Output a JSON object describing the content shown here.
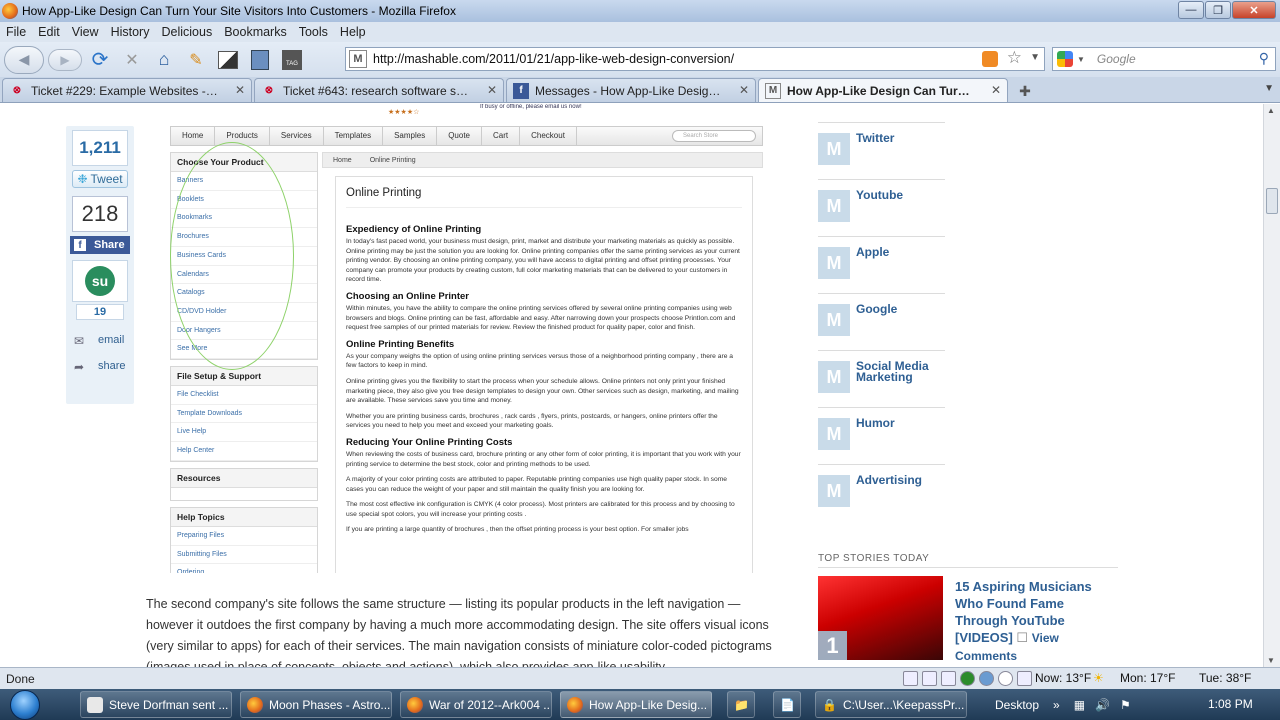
{
  "window": {
    "title": "How App-Like Design Can Turn Your Site Visitors Into Customers - Mozilla Firefox"
  },
  "menu": [
    "File",
    "Edit",
    "View",
    "History",
    "Delicious",
    "Bookmarks",
    "Tools",
    "Help"
  ],
  "nav": {
    "url": "http://mashable.com/2011/01/21/app-like-web-design-conversion/",
    "search_placeholder": "Google",
    "tag_label": "TAG"
  },
  "tabs": [
    {
      "label": "Ticket #229: Example Websites - Ide...",
      "icon": "trac-icon",
      "active": false
    },
    {
      "label": "Ticket #643: research software so th...",
      "icon": "trac-icon",
      "active": false
    },
    {
      "label": "Messages - How App-Like Design C...",
      "icon": "facebook-icon",
      "active": false
    },
    {
      "label": "How App-Like Design Can Turn Y...",
      "icon": "mashable-icon",
      "active": true
    }
  ],
  "share": {
    "tweet_count": "1,211",
    "tweet_label": "Tweet",
    "fb_count": "218",
    "fb_label": "Share",
    "su_count": "19",
    "email_label": "email",
    "share_label": "share"
  },
  "shot": {
    "top_hint": "If busy or offline, please email us now!",
    "topnav": [
      "Home",
      "Products",
      "Services",
      "Templates",
      "Samples",
      "Quote",
      "Cart",
      "Checkout"
    ],
    "search_placeholder": "Search Store",
    "choose_title": "Choose Your Product",
    "products": [
      "Banners",
      "Booklets",
      "Bookmarks",
      "Brochures",
      "Business Cards",
      "Calendars",
      "Catalogs",
      "CD/DVD Holder",
      "Door Hangers",
      "See More"
    ],
    "setup_title": "File Setup & Support",
    "setup": [
      "File Checklist",
      "Template Downloads",
      "Live Help",
      "Help Center"
    ],
    "resources_title": "Resources",
    "help_title": "Help Topics",
    "help": [
      "Preparing Files",
      "Submitting Files",
      "Ordering"
    ],
    "crumb": [
      "Home",
      "Online Printing"
    ],
    "page_title": "Online Printing",
    "sections": [
      {
        "h": "Expediency of Online Printing",
        "p": [
          "In today's fast paced world, your business must design, print, market and distribute your marketing materials as quickly as possible. Online printing may be just the solution you are looking for. Online printing companies offer the same printing services as your current printing vendor. By choosing an online printing company, you will have access to digital printing and offset printing processes. Your company can promote your products by creating custom, full color marketing materials that can be delivered to your customers in record time."
        ]
      },
      {
        "h": "Choosing an Online Printer",
        "p": [
          "Within minutes, you have the ability to compare the online printing services offered by several online printing companies using web browsers and blogs. Online printing can be fast, affordable and easy. After narrowing down your prospects choose PrintIon.com and request free samples of our printed materials for review. Review the finished product for quality paper, color and finish."
        ]
      },
      {
        "h": "Online Printing Benefits",
        "p": [
          "As your company weighs the option of using online printing services versus those of a neighborhood printing company , there are a few factors to keep in mind.",
          "Online printing gives you the flexibility to start the process when your schedule allows. Online printers not only print your finished marketing piece, they also give you free design templates to design your own. Other services such as design, marketing, and mailing are available. These services save you time and money.",
          "Whether you are printing business cards, brochures , rack cards , flyers, prints, postcards, or hangers, online printers offer the services you need to help you meet and exceed your marketing goals."
        ]
      },
      {
        "h": "Reducing Your Online Printing Costs",
        "p": [
          "When reviewing the costs of business card, brochure printing or any other form of color printing, it is important that you work with your printing service to determine the best stock, color and printing methods to be used.",
          "A majority of your color printing costs are attributed to paper. Reputable printing companies use high quality paper stock. In some cases you can reduce the weight of your paper and still maintain the quality finish you are looking for.",
          "The most cost effective ink configuration is CMYK (4 color process). Most printers are calibrated for this process and by choosing to use special spot colors, you will increase your printing costs .",
          "If you are printing a large quantity of brochures , then the offset printing process is your best option. For smaller jobs"
        ]
      }
    ]
  },
  "body_text": "The second company's site follows the same structure — listing its popular products in the left navigation — however it outdoes the first company by having a much more accommodating design. The site offers visual icons (very similar to apps) for each of their services. The main navigation consists of miniature color-coded pictograms (images used in place of concepts, objects and actions), which also provides app-like usability.",
  "sidebar": [
    "Twitter",
    "Youtube",
    "Apple",
    "Google",
    "Social Media Marketing",
    "Humor",
    "Advertising"
  ],
  "top_stories": {
    "heading": "TOP STORIES TODAY",
    "rank": "1",
    "title": "15 Aspiring Musicians Who Found Fame Through YouTube [VIDEOS]",
    "view": "View Comments"
  },
  "status": {
    "text": "Done",
    "now": "Now: 13°F",
    "mon": "Mon: 17°F",
    "tue": "Tue: 38°F"
  },
  "taskbar": {
    "items": [
      "Steve Dorfman sent ...",
      "Moon Phases - Astro...",
      "War of 2012--Ark004 ...",
      "How App-Like Desig...",
      "C:\\User...\\KeepassPr..."
    ],
    "desktop": "Desktop",
    "time": "1:08 PM"
  },
  "colors": {
    "link": "#2e5f93",
    "accent_green": "#8ed26a",
    "facebook": "#3b5998"
  }
}
